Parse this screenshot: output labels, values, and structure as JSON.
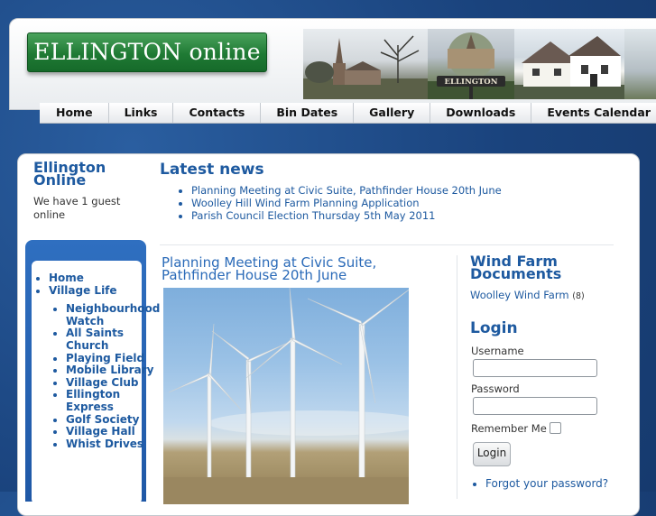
{
  "header": {
    "logo_text": "ELLINGTON online",
    "village_sign_text": "ELLINGTON"
  },
  "nav": {
    "items": [
      "Home",
      "Links",
      "Contacts",
      "Bin Dates",
      "Gallery",
      "Downloads",
      "Events Calendar"
    ]
  },
  "left": {
    "site_title": "Ellington Online",
    "guests_text": "We have 1 guest online",
    "menu": {
      "home": "Home",
      "village_life": "Village Life",
      "sub_items": [
        "Neighbourhood Watch",
        "All Saints Church",
        "Playing Field",
        "Mobile Library",
        "Village Club",
        "Ellington Express",
        "Golf Society",
        "Village Hall",
        "Whist Drives"
      ]
    }
  },
  "latest_news": {
    "title": "Latest news",
    "items": [
      "Planning Meeting at Civic Suite, Pathfinder House 20th June",
      "Woolley Hill Wind Farm Planning Application",
      "Parish Council Election Thursday 5th May 2011"
    ]
  },
  "article": {
    "title": "Planning Meeting at Civic Suite, Pathfinder House 20th June"
  },
  "right": {
    "wind_farm_title": "Wind Farm Documents",
    "wind_farm_link": "Woolley Wind Farm",
    "wind_farm_count": "(8)",
    "login_title": "Login",
    "username_label": "Username",
    "password_label": "Password",
    "remember_label": "Remember Me",
    "login_button": "Login",
    "forgot_link": "Forgot your password?"
  },
  "colors": {
    "background": "#1d4a86",
    "link_blue": "#1e5aa0",
    "logo_green": "#1f7a34",
    "sidebar_blue": "#2a66b6"
  }
}
